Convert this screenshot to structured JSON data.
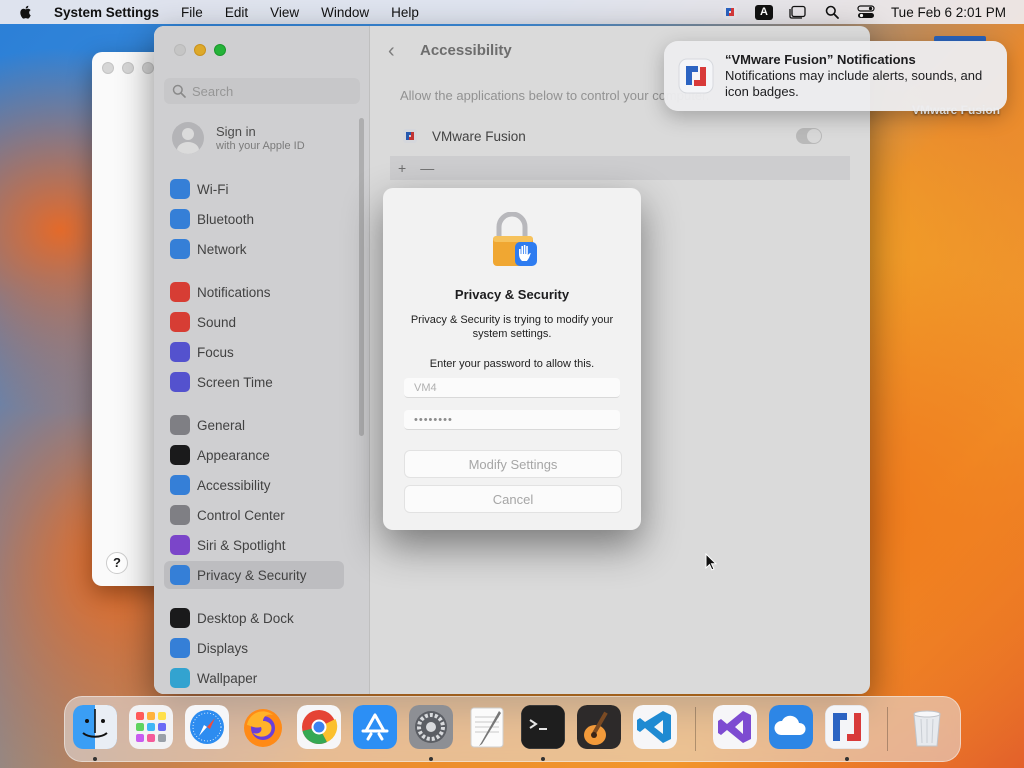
{
  "menubar": {
    "app_name": "System Settings",
    "items": [
      "File",
      "Edit",
      "View",
      "Window",
      "Help"
    ],
    "clock": "Tue Feb 6  2:01 PM",
    "input_letter": "A"
  },
  "sidebar": {
    "search_placeholder": "Search",
    "signin_title": "Sign in",
    "signin_subtitle": "with your Apple ID",
    "items": [
      {
        "label": "Wi-Fi",
        "icon": "wifi-icon",
        "color": "#3b8ef0"
      },
      {
        "label": "Bluetooth",
        "icon": "bluetooth-icon",
        "color": "#3b8ef0"
      },
      {
        "label": "Network",
        "icon": "network-icon",
        "color": "#3b8ef0"
      },
      {
        "label": "Notifications",
        "icon": "notifications-icon",
        "color": "#f0453a"
      },
      {
        "label": "Sound",
        "icon": "sound-icon",
        "color": "#f0453a"
      },
      {
        "label": "Focus",
        "icon": "focus-icon",
        "color": "#5e5ce6"
      },
      {
        "label": "Screen Time",
        "icon": "hourglass-icon",
        "color": "#5e5ce6"
      },
      {
        "label": "General",
        "icon": "gear-icon",
        "color": "#8e8e93"
      },
      {
        "label": "Appearance",
        "icon": "appearance-icon",
        "color": "#1d1d1f"
      },
      {
        "label": "Accessibility",
        "icon": "accessibility-icon",
        "color": "#3b8ef0"
      },
      {
        "label": "Control Center",
        "icon": "control-center-icon",
        "color": "#8e8e93"
      },
      {
        "label": "Siri & Spotlight",
        "icon": "siri-icon",
        "color": "#8a4de0"
      },
      {
        "label": "Privacy & Security",
        "icon": "hand-icon",
        "color": "#3b8ef0"
      },
      {
        "label": "Desktop & Dock",
        "icon": "desktop-icon",
        "color": "#1d1d1f"
      },
      {
        "label": "Displays",
        "icon": "displays-icon",
        "color": "#3b8ef0"
      },
      {
        "label": "Wallpaper",
        "icon": "wallpaper-icon",
        "color": "#39b6e8"
      }
    ]
  },
  "content": {
    "title": "Accessibility",
    "description": "Allow the applications below to control your computer.",
    "app_name": "VMware Fusion",
    "add_label": "+",
    "remove_label": "—"
  },
  "dialog": {
    "title": "Privacy & Security",
    "message": "Privacy & Security is trying to modify your system settings.",
    "prompt": "Enter your password to allow this.",
    "username": "VM4",
    "password": "••••••••",
    "modify_label": "Modify Settings",
    "cancel_label": "Cancel"
  },
  "notification": {
    "title": "“VMware Fusion” Notifications",
    "body": "Notifications may include alerts, sounds, and icon badges."
  },
  "desktop": {
    "icon_label": "VMware Fusion"
  },
  "back_window": {
    "help_label": "?"
  },
  "dock": {
    "apps": [
      "finder-icon",
      "launchpad-icon",
      "safari-icon",
      "firefox-icon",
      "chrome-icon",
      "app-store-icon",
      "system-settings-icon",
      "textedit-icon",
      "terminal-icon",
      "garageband-icon",
      "vscode-icon",
      "visual-studio-icon",
      "cloud-app-icon",
      "vmware-fusion-icon",
      "trash-icon"
    ]
  }
}
